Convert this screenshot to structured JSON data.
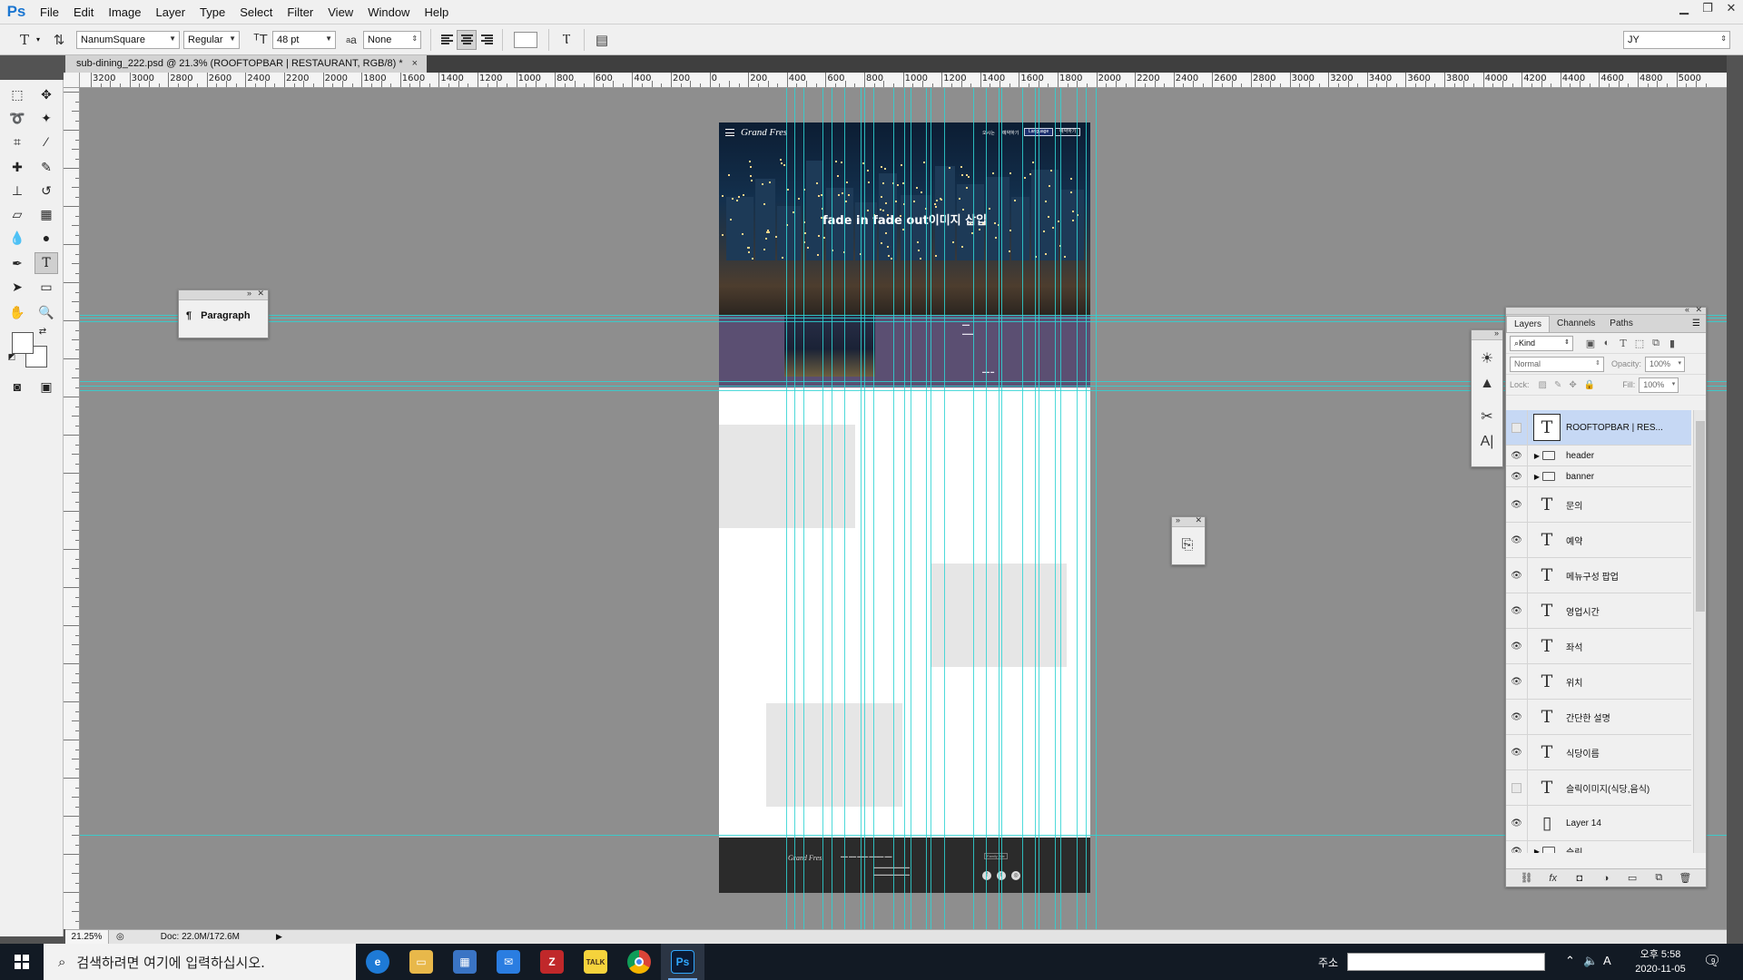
{
  "app": {
    "logo": "Ps"
  },
  "menu": [
    "File",
    "Edit",
    "Image",
    "Layer",
    "Type",
    "Select",
    "Filter",
    "View",
    "Window",
    "Help"
  ],
  "options": {
    "font_family": "NanumSquare",
    "font_style": "Regular",
    "font_size": "48 pt",
    "aa_label": "a",
    "antialias": "None",
    "workspace": "JY"
  },
  "document": {
    "tab_title": "sub-dining_222.psd @ 21.3% (ROOFTOPBAR   |   RESTAURANT, RGB/8) *",
    "close": "×"
  },
  "ruler_top_labels": [
    "3200",
    "3000",
    "2800",
    "2600",
    "2400",
    "2200",
    "2000",
    "1800",
    "1600",
    "1400",
    "1200",
    "1000",
    "800",
    "600",
    "400",
    "200",
    "0",
    "200",
    "400",
    "600",
    "800",
    "1000",
    "1200",
    "1400",
    "1600",
    "1800",
    "2000",
    "2200",
    "2400",
    "2600",
    "2800",
    "3000",
    "3200",
    "3400",
    "3600",
    "3800",
    "4000",
    "4200",
    "4400",
    "4600",
    "4800",
    "5000"
  ],
  "artboard": {
    "nav_logo": "Grand Fres",
    "nav_links": [
      "오시는",
      "예약하기"
    ],
    "nav_buttons": [
      "Language",
      "예약하기"
    ],
    "hero_caption": "fade in fade out이미지 삽입",
    "footer_logo": "Grand Fres",
    "footer_select": "Family Site"
  },
  "panels": {
    "paragraph_label": "Paragraph",
    "paragraph_icon": "¶"
  },
  "layers_panel": {
    "tabs": [
      "Layers",
      "Channels",
      "Paths"
    ],
    "filter_kind": "Kind",
    "blend_mode": "Normal",
    "opacity_label": "Opacity:",
    "opacity_value": "100%",
    "lock_label": "Lock:",
    "fill_label": "Fill:",
    "fill_value": "100%",
    "layers": [
      {
        "name": "ROOFTOPBAR   |   RES...",
        "type": "text",
        "visible": false,
        "selected": true
      },
      {
        "name": "header",
        "type": "group",
        "visible": true
      },
      {
        "name": "banner",
        "type": "group",
        "visible": true
      },
      {
        "name": "문의",
        "type": "text",
        "visible": true
      },
      {
        "name": "예약",
        "type": "text",
        "visible": true
      },
      {
        "name": "메뉴구성 팝업",
        "type": "text",
        "visible": true
      },
      {
        "name": "영업시간",
        "type": "text",
        "visible": true
      },
      {
        "name": "좌석",
        "type": "text",
        "visible": true
      },
      {
        "name": "위치",
        "type": "text",
        "visible": true
      },
      {
        "name": "간단한 설명",
        "type": "text",
        "visible": true
      },
      {
        "name": "식당이름",
        "type": "text",
        "visible": true
      },
      {
        "name": "슬릭이미지(식당,음식)",
        "type": "text",
        "visible": false
      },
      {
        "name": "Layer 14",
        "type": "pixel",
        "visible": true
      },
      {
        "name": "슬릭",
        "type": "group",
        "visible": true
      }
    ]
  },
  "status": {
    "zoom": "21.25%",
    "doc": "Doc: 22.0M/172.6M"
  },
  "taskbar": {
    "search_placeholder": "검색하려면 여기에 입력하십시오.",
    "address_label": "주소",
    "clock_time": "오후 5:58",
    "clock_date": "2020-11-05",
    "notifications": "9",
    "ime": "A"
  }
}
